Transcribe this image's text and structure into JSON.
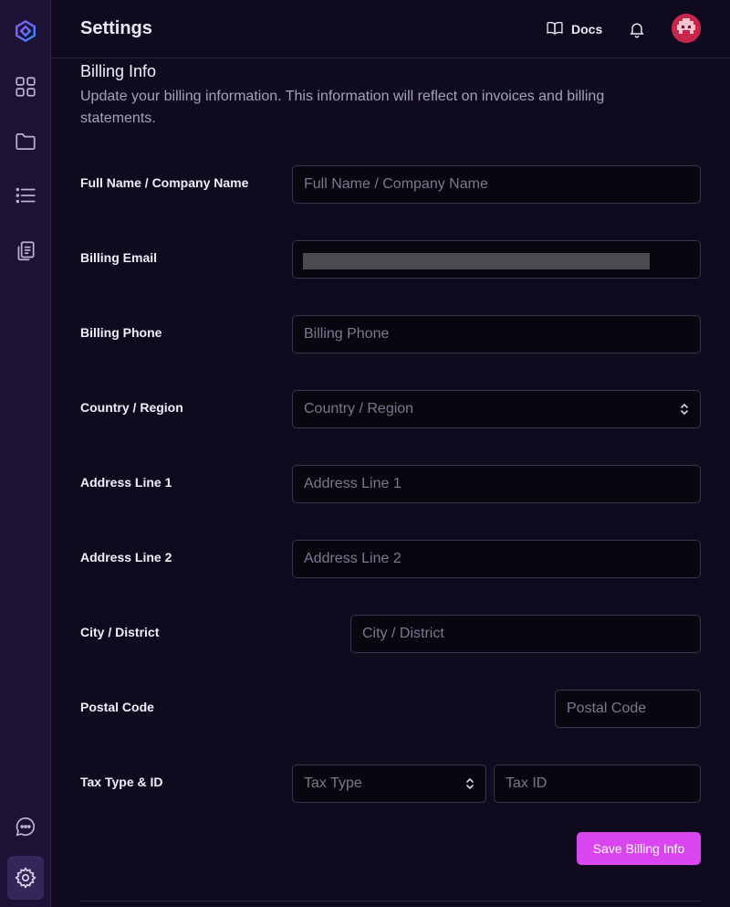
{
  "header": {
    "title": "Settings",
    "docs_label": "Docs"
  },
  "sidebar": {
    "items": [
      {
        "icon": "grid-icon"
      },
      {
        "icon": "folder-icon"
      },
      {
        "icon": "list-icon"
      },
      {
        "icon": "documents-icon"
      }
    ],
    "bottom": [
      {
        "icon": "chat-icon"
      },
      {
        "icon": "gear-icon",
        "active": true
      }
    ]
  },
  "billing": {
    "title": "Billing Info",
    "description": "Update your billing information. This information will reflect on invoices and billing statements.",
    "fields": {
      "full_name": {
        "label": "Full Name / Company Name",
        "placeholder": "Full Name / Company Name"
      },
      "email": {
        "label": "Billing Email",
        "value": ""
      },
      "phone": {
        "label": "Billing Phone",
        "placeholder": "Billing Phone"
      },
      "country": {
        "label": "Country / Region",
        "placeholder": "Country / Region"
      },
      "address1": {
        "label": "Address Line 1",
        "placeholder": "Address Line 1"
      },
      "address2": {
        "label": "Address Line 2",
        "placeholder": "Address Line 2"
      },
      "city": {
        "label": "City / District",
        "placeholder": "City / District"
      },
      "postal": {
        "label": "Postal Code",
        "placeholder": "Postal Code"
      },
      "tax": {
        "label": "Tax Type & ID",
        "type_placeholder": "Tax Type",
        "id_placeholder": "Tax ID"
      }
    },
    "save_label": "Save Billing Info"
  },
  "colors": {
    "accent": "#d946ef",
    "background": "#100a1f",
    "sidebar": "#1c1236"
  }
}
